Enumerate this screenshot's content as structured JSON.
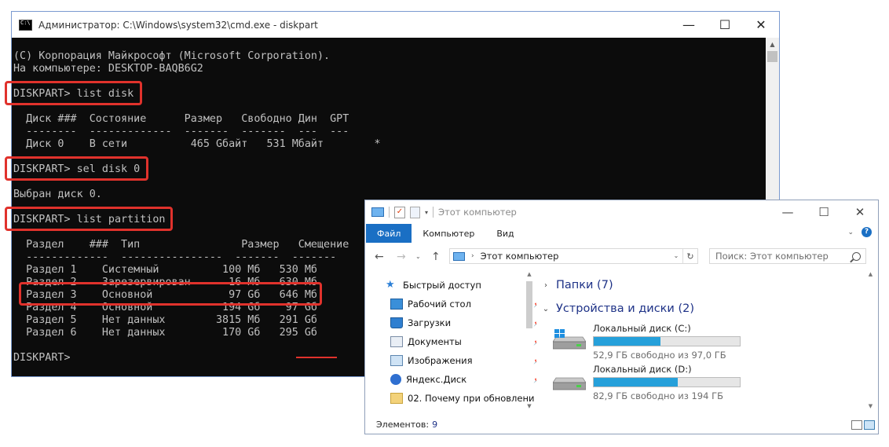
{
  "cmd": {
    "title": "Администратор: C:\\Windows\\system32\\cmd.exe - diskpart",
    "lines": [
      "(C) Корпорация Майкрософт (Microsoft Corporation).",
      "На компьютере: DESKTOP-BAQB6G2",
      "",
      "DISKPART> list disk",
      "",
      "  Диск ###  Состояние      Размер   Свободно Дин  GPT",
      "  --------  -------------  -------  -------  ---  ---",
      "  Диск 0    В сети          465 Gбайт   531 Mбайт        *",
      "",
      "DISKPART> sel disk 0",
      "",
      "Выбран диск 0.",
      "",
      "DISKPART> list partition",
      "",
      "  Раздел    ###  Тип                Размер   Смещение",
      "  -------------  ----------------  -------  -------",
      "  Раздел 1    Системный          100 Мб   530 Мб",
      "  Раздел 2    Зарезервирован      16 Мб   630 Мб",
      "  Раздел 3    Основной            97 Gб   646 Мб",
      "  Раздел 4    Основной           194 Gб    97 Gб",
      "  Раздел 5    Нет данных        3815 Мб   291 Gб",
      "  Раздел 6    Нет данных         170 Gб   295 Gб",
      "",
      "DISKPART>"
    ],
    "controls": {
      "minimize": "—",
      "maximize": "☐",
      "close": "✕"
    }
  },
  "explorer": {
    "title": "Этот компьютер",
    "controls": {
      "minimize": "—",
      "maximize": "☐",
      "close": "✕"
    },
    "ribbon_tabs": [
      "Файл",
      "Компьютер",
      "Вид"
    ],
    "address": "Этот компьютер",
    "search_placeholder": "Поиск: Этот компьютер",
    "nav_items": [
      {
        "label": "Быстрый доступ",
        "icon": "star-icon",
        "pinned": false
      },
      {
        "label": "Рабочий стол",
        "icon": "desktop-folder-icon",
        "pinned": true
      },
      {
        "label": "Загрузки",
        "icon": "downloads-icon",
        "pinned": true
      },
      {
        "label": "Документы",
        "icon": "documents-icon",
        "pinned": true
      },
      {
        "label": "Изображения",
        "icon": "pictures-icon",
        "pinned": true
      },
      {
        "label": "Яндекс.Диск",
        "icon": "yandex-disk-icon",
        "pinned": true
      },
      {
        "label": "02. Почему при обновлени",
        "icon": "folder-icon",
        "pinned": false
      }
    ],
    "groups": {
      "folders": "Папки (7)",
      "devices": "Устройства и диски (2)"
    },
    "drives": [
      {
        "name": "Локальный диск (C:)",
        "free_text": "52,9 ГБ свободно из 97,0 ГБ",
        "used_fraction": 0.455,
        "system": true
      },
      {
        "name": "Локальный диск (D:)",
        "free_text": "82,9 ГБ свободно из 194 ГБ",
        "used_fraction": 0.573,
        "system": false
      }
    ],
    "status": {
      "label": "Элементов:",
      "count": "9"
    },
    "colors": {
      "accent": "#1a6fc4",
      "bar": "#26a0da",
      "highlight": "#e0322c"
    }
  }
}
